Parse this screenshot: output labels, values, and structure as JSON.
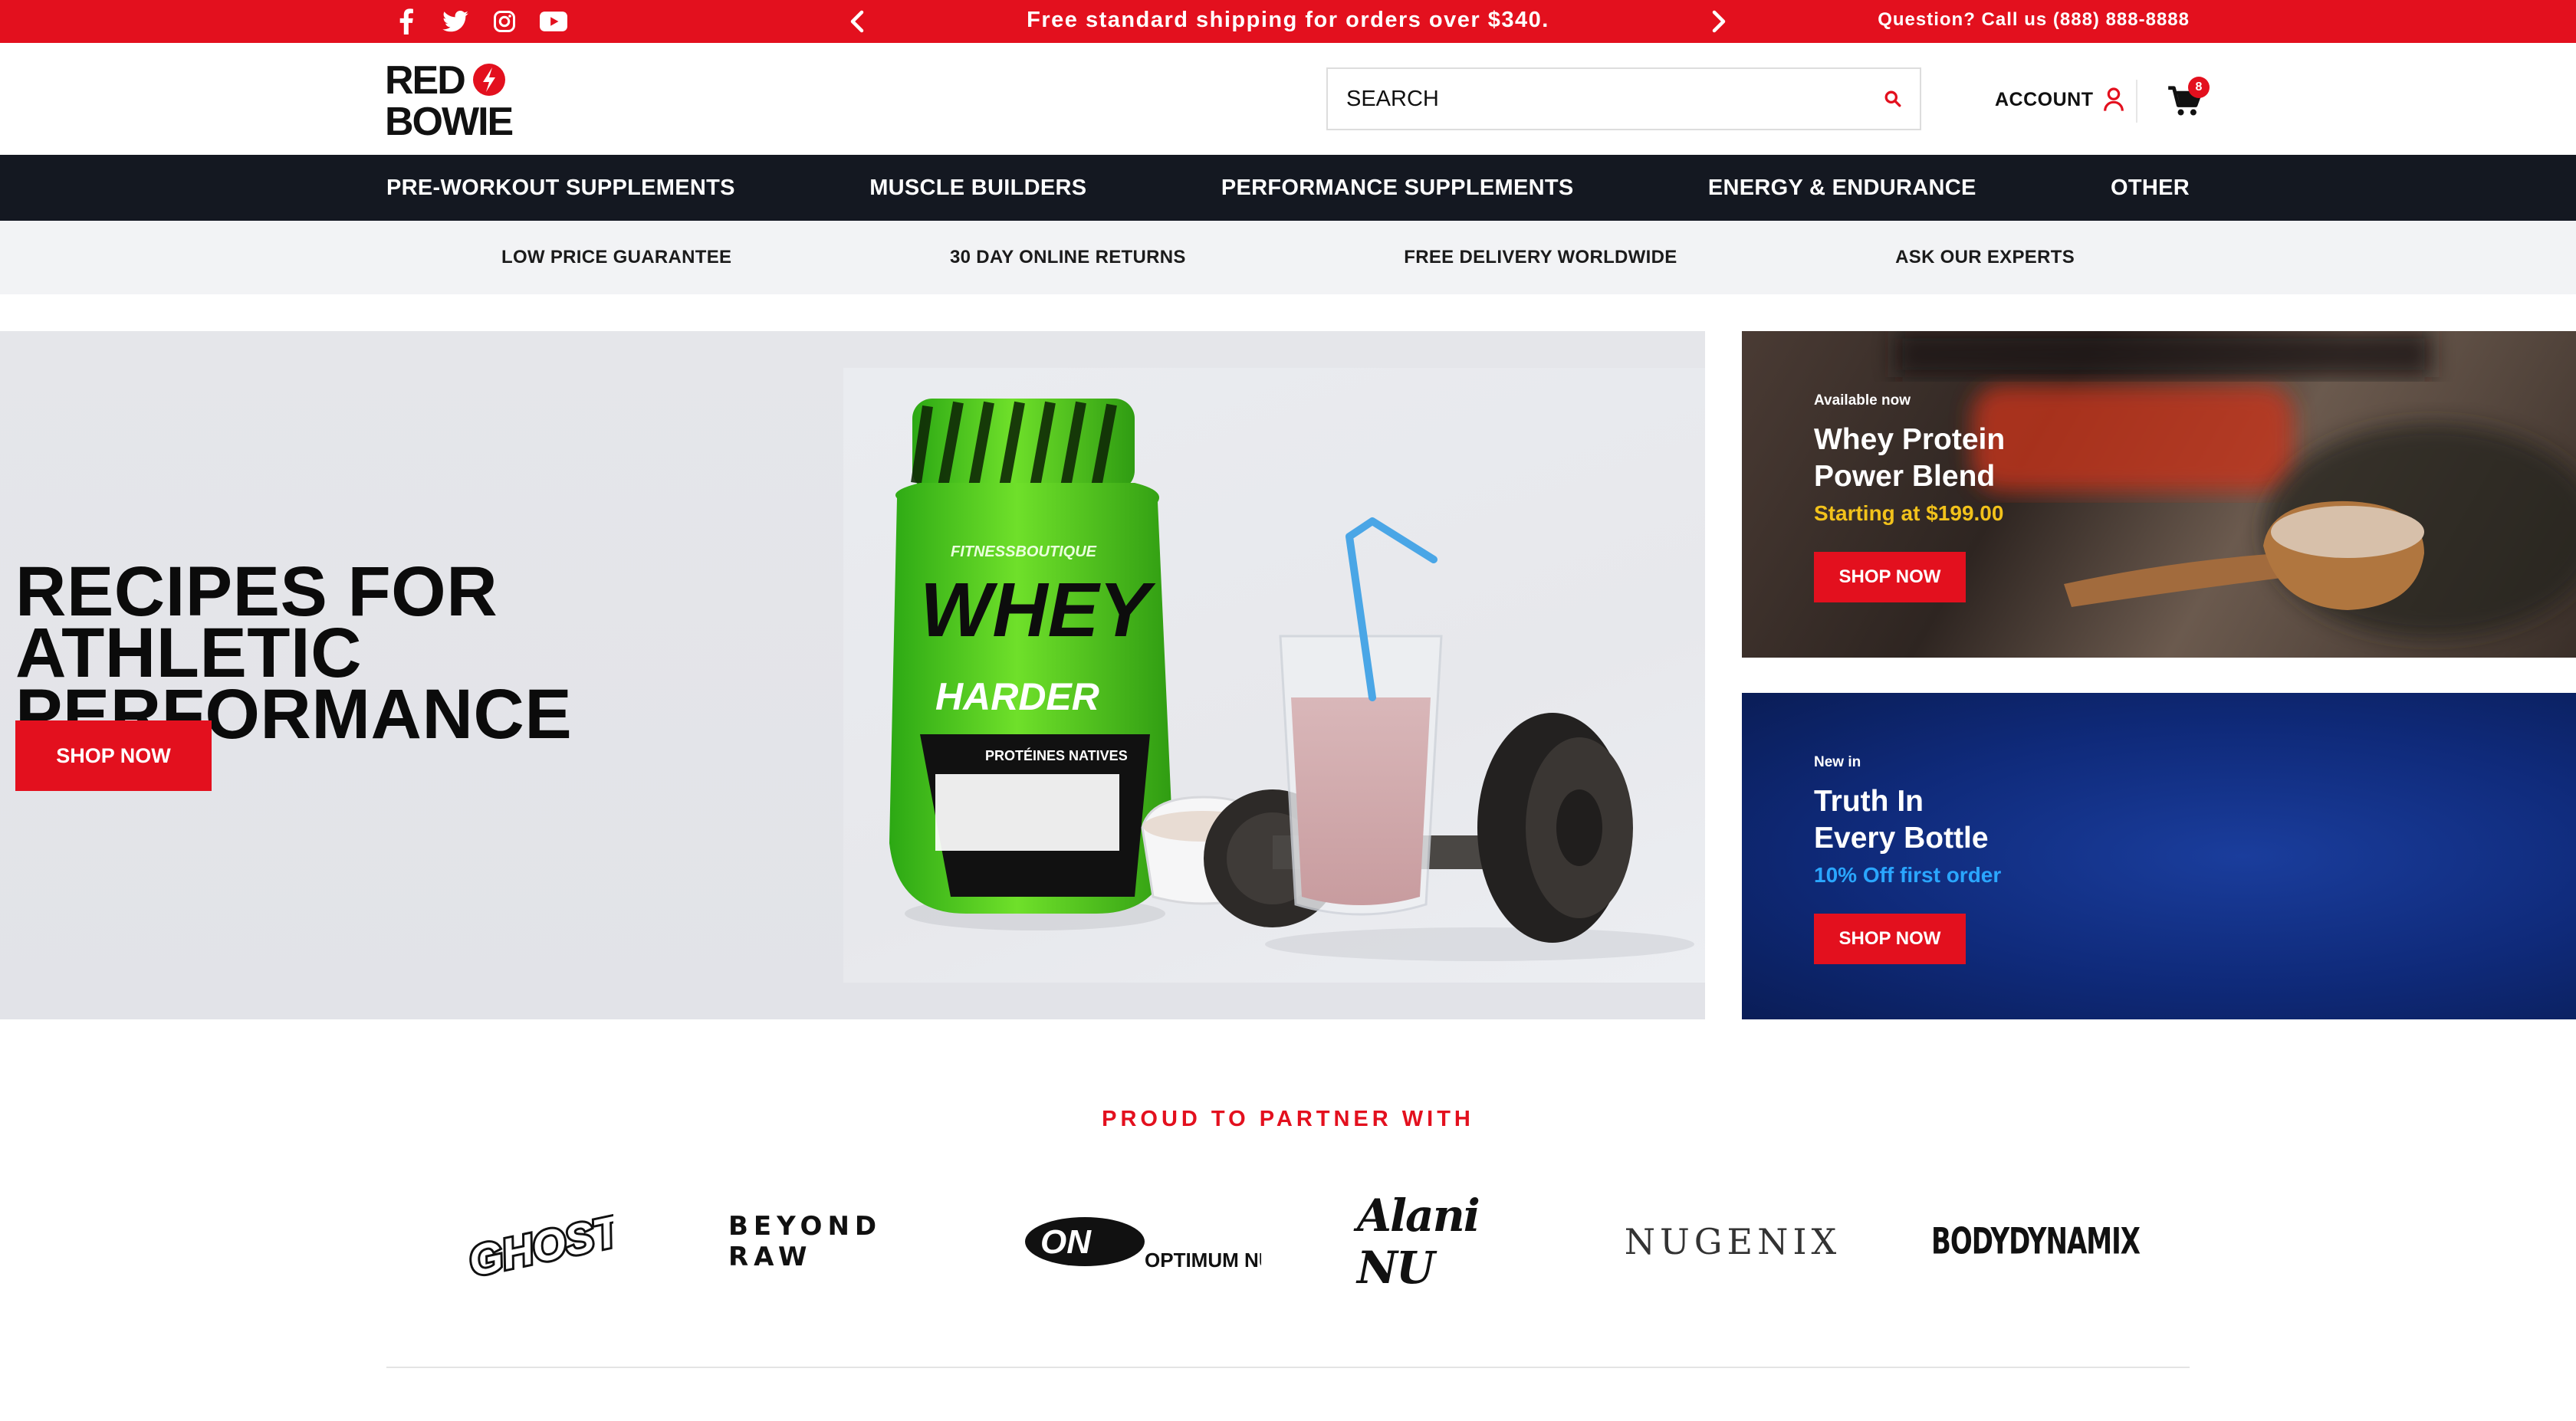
{
  "topbar": {
    "social": [
      "facebook-icon",
      "twitter-icon",
      "instagram-icon",
      "youtube-icon"
    ],
    "promo": "Free standard shipping for orders over $340.",
    "phone": "Question? Call us (888) 888-8888"
  },
  "header": {
    "logo_line1": "RED",
    "logo_line2": "BOWIE",
    "search_placeholder": "SEARCH",
    "account_label": "ACCOUNT",
    "cart_count": "8"
  },
  "nav": {
    "items": [
      "PRE-WORKOUT SUPPLEMENTS",
      "MUSCLE BUILDERS",
      "PERFORMANCE SUPPLEMENTS",
      "ENERGY & ENDURANCE",
      "OTHER"
    ]
  },
  "usp": {
    "items": [
      "LOW PRICE GUARANTEE",
      "30 DAY ONLINE RETURNS",
      "FREE DELIVERY WORLDWIDE",
      "ASK OUR EXPERTS"
    ]
  },
  "hero": {
    "title_line1": "RECIPES FOR ATHLETIC",
    "title_line2": "PERFORMANCE",
    "button": "SHOP NOW",
    "tub_brand": "FITNESSBOUTIQUE",
    "tub_word1": "WHEY",
    "tub_word2": "HARDER",
    "tub_sub": "PROTÉINES NATIVES"
  },
  "tiles": [
    {
      "kicker": "Available now",
      "title_line1": "Whey Protein",
      "title_line2": "Power Blend",
      "sub": "Starting at $199.00",
      "button": "SHOP NOW"
    },
    {
      "kicker": "New in",
      "title_line1": "Truth In",
      "title_line2": "Every Bottle",
      "sub": "10% Off first order",
      "button": "SHOP NOW"
    }
  ],
  "partners": {
    "title": "PROUD TO PARTNER WITH",
    "brands": [
      "GHOST",
      "BEYOND RAW",
      "OPTIMUM NUTRITION",
      "Alani NU",
      "NUGENIX",
      "BODYDYNAMIX"
    ]
  },
  "colors": {
    "brand_red": "#e3101e",
    "nav_dark": "#141821",
    "usp_bg": "#f2f3f5",
    "tile1_accent": "#f2c21b",
    "tile2_accent": "#2aa6ff"
  }
}
